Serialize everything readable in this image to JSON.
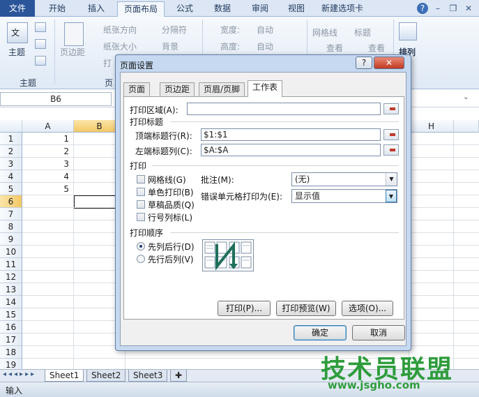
{
  "ribbon_tabs": [
    "文件",
    "开始",
    "插入",
    "页面布局",
    "公式",
    "数据",
    "审阅",
    "视图",
    "新建选项卡"
  ],
  "ribbon": {
    "theme_btn": "主题",
    "margins_btn": "页边距",
    "orientation": "纸张方向",
    "size": "纸张大小",
    "print_area": "打",
    "breaks": "分隔符",
    "background": "背景",
    "width_label": "宽度:",
    "width_value": "自动",
    "height_label": "高度:",
    "height_value": "自动",
    "gridlines": "网格线",
    "headings": "标题",
    "view1": "查看",
    "view2": "查看",
    "arrange": "排列",
    "group_theme": "主题",
    "group_page": "页",
    "text_char": "文"
  },
  "formula_bar": {
    "name_box": "B6"
  },
  "grid": {
    "columns": [
      "A",
      "B",
      "H"
    ],
    "rows": [
      "1",
      "2",
      "3",
      "4",
      "5",
      "6",
      "7",
      "8",
      "9",
      "10",
      "11",
      "12",
      "13",
      "14",
      "15",
      "16",
      "17",
      "18",
      "19"
    ],
    "values_a": [
      "1",
      "2",
      "3",
      "4",
      "5"
    ]
  },
  "sheet_tabs": [
    "Sheet1",
    "Sheet2",
    "Sheet3"
  ],
  "status_text": "输入",
  "dialog": {
    "title": "页面设置",
    "help": "?",
    "close": "✕",
    "tabs": [
      "页面",
      "页边距",
      "页眉/页脚",
      "工作表"
    ],
    "print_area_label": "打印区域(A):",
    "print_area_value": "",
    "print_titles_section": "打印标题",
    "rows_repeat_label": "顶端标题行(R):",
    "rows_repeat_value": "$1:$1",
    "cols_repeat_label": "左端标题列(C):",
    "cols_repeat_value": "$A:$A",
    "print_section": "打印",
    "gridlines": "网格线(G)",
    "black_white": "单色打印(B)",
    "draft": "草稿品质(Q)",
    "row_col_headings": "行号列标(L)",
    "comments_label": "批注(M):",
    "comments_value": "(无)",
    "errors_label": "错误单元格打印为(E):",
    "errors_value": "显示值",
    "page_order_section": "打印顺序",
    "down_then_over": "先列后行(D)",
    "over_then_down": "先行后列(V)",
    "print_btn": "打印(P)...",
    "preview_btn": "打印预览(W)",
    "options_btn": "选项(O)...",
    "ok_btn": "确定",
    "cancel_btn": "取消"
  },
  "watermark": {
    "line1": "技术员联盟",
    "line2": "www.jsgho.com"
  }
}
